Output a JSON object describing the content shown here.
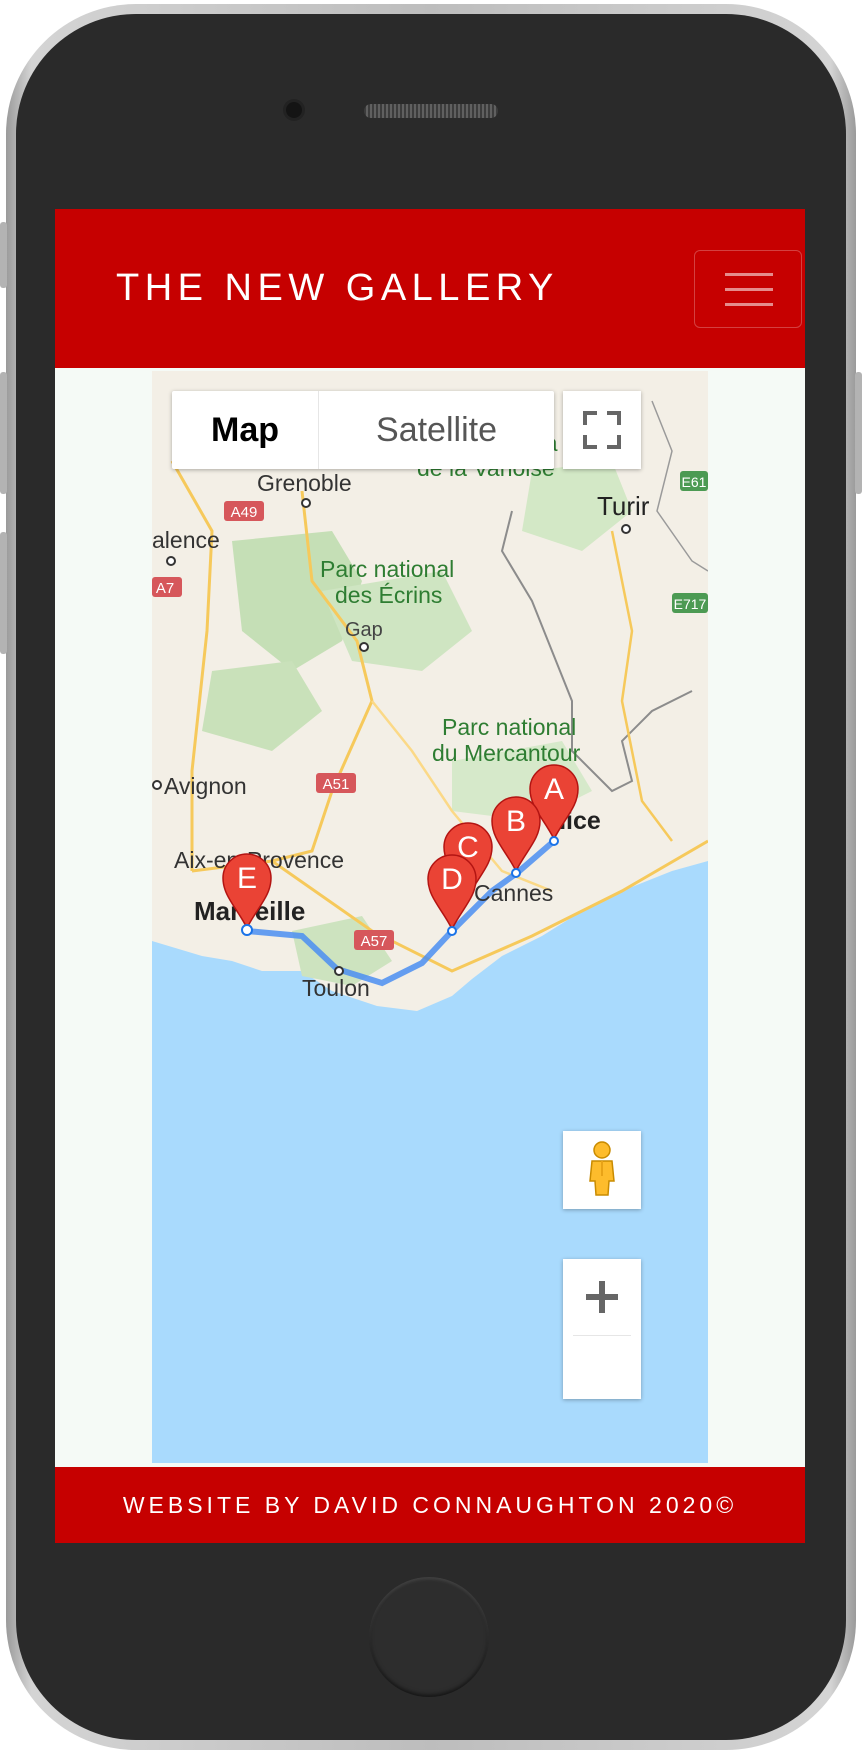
{
  "header": {
    "brand": "THE NEW GALLERY"
  },
  "map": {
    "type_options": [
      "Map",
      "Satellite"
    ],
    "selected_type": "Map",
    "markers": [
      "A",
      "B",
      "C",
      "D",
      "E"
    ],
    "labels": {
      "grenoble": "Grenoble",
      "valence": "alence",
      "turin": "Turir",
      "avignon": "Avignon",
      "aix": "Aix-en-Provence",
      "marseille": "Marseille",
      "toulon": "Toulon",
      "cannes": "Cannes",
      "gap": "Gap",
      "nice": "Nice",
      "ecrins_1": "Parc national",
      "ecrins_2": "des Écrins",
      "mercantour_1": "Parc national",
      "mercantour_2": "du Mercantour",
      "vanoise_1": "iona",
      "vanoise_2": "de la Vanoise"
    },
    "road_shields": [
      "A49",
      "A7",
      "A51",
      "A57",
      "E61",
      "E717"
    ]
  },
  "footer": {
    "text": "WEBSITE BY DAVID CONNAUGHTON 2020©"
  },
  "colors": {
    "brand_red": "#c60000",
    "marker_red": "#ea4335",
    "water": "#a9dafd",
    "route": "#4a8ef1"
  }
}
